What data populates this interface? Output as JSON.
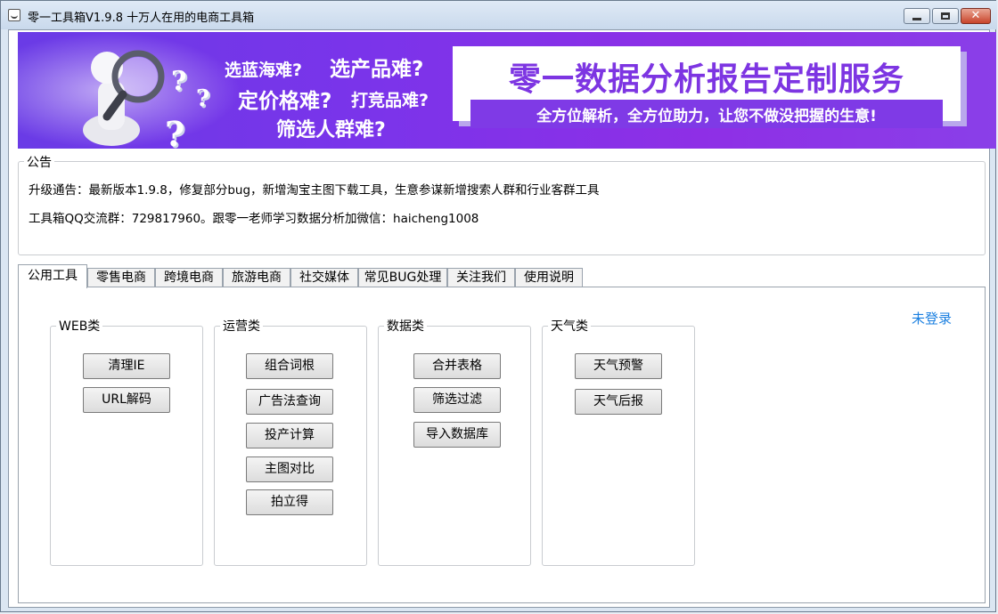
{
  "window": {
    "title": "零一工具箱V1.9.8 十万人在用的电商工具箱",
    "minimize_icon": "minimize-icon",
    "maximize_icon": "maximize-icon",
    "close_icon": "close-icon",
    "close_glyph": "✕"
  },
  "banner": {
    "slogan_1a": "选蓝海难?",
    "slogan_1b": "选产品难?",
    "slogan_2a": "定价格难?",
    "slogan_2b": "打竞品难?",
    "slogan_3": "筛选人群难?",
    "question_mark": "?",
    "headline": "零一数据分析报告定制服务",
    "subline": "全方位解析，全方位助力，让您不做没把握的生意!",
    "accent_color": "#7d35e2"
  },
  "notice": {
    "label": "公告",
    "line1": "升级通告：最新版本1.9.8，修复部分bug，新增淘宝主图下载工具，生意参谋新增搜索人群和行业客群工具",
    "line2": "工具箱QQ交流群：729817960。跟零一老师学习数据分析加微信：haicheng1008"
  },
  "tabs": [
    {
      "label": "公用工具",
      "active": true
    },
    {
      "label": "零售电商"
    },
    {
      "label": "跨境电商"
    },
    {
      "label": "旅游电商"
    },
    {
      "label": "社交媒体"
    },
    {
      "label": "常见BUG处理"
    },
    {
      "label": "关注我们"
    },
    {
      "label": "使用说明"
    }
  ],
  "login_status": "未登录",
  "groups": [
    {
      "title": "WEB类",
      "buttons": [
        "清理IE",
        "URL解码"
      ]
    },
    {
      "title": "运营类",
      "buttons": [
        "组合词根",
        "广告法查询",
        "投产计算",
        "主图对比",
        "拍立得"
      ]
    },
    {
      "title": "数据类",
      "buttons": [
        "合并表格",
        "筛选过滤",
        "导入数据库"
      ]
    },
    {
      "title": "天气类",
      "buttons": [
        "天气预警",
        "天气后报"
      ]
    }
  ]
}
